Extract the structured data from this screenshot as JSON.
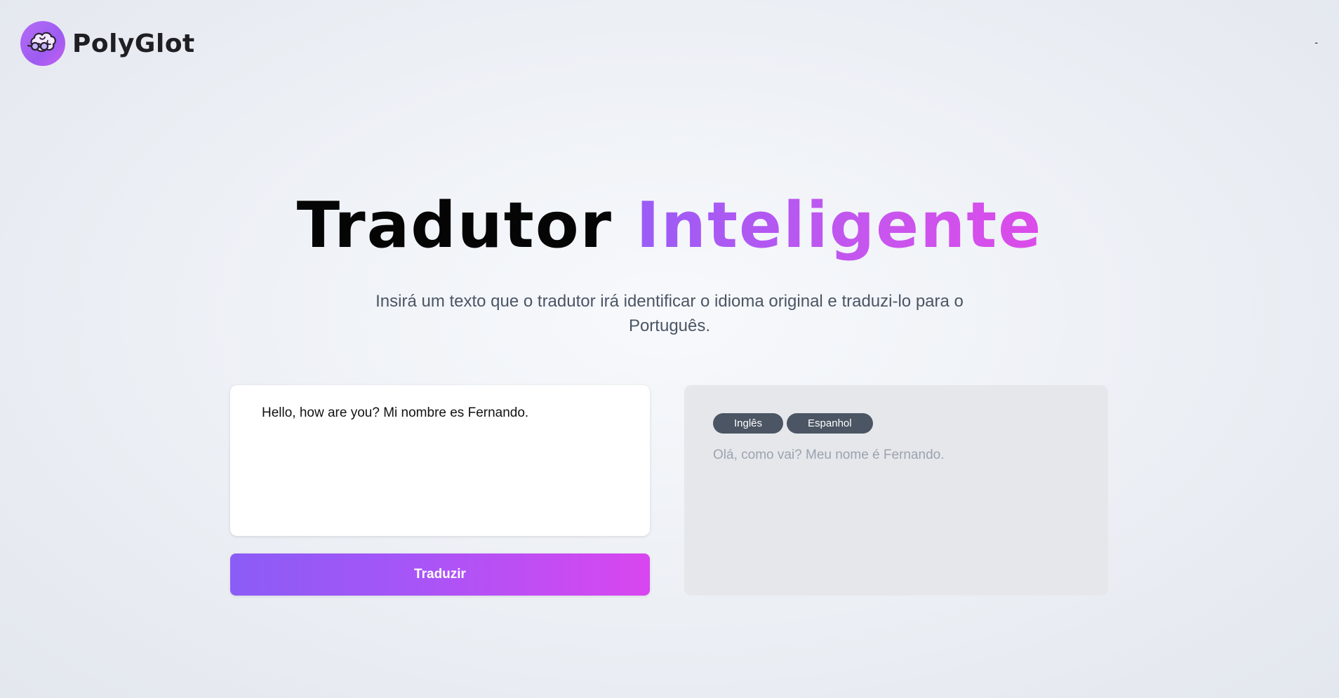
{
  "header": {
    "brand": "PolyGlot",
    "logo_icon": "brain-with-glasses-icon",
    "right_text": "-"
  },
  "hero": {
    "title_plain": "Tradutor",
    "title_highlight": "Inteligente",
    "subtitle": "Insirá um texto que o tradutor irá identificar o idioma original e traduzi-lo para o Português."
  },
  "input": {
    "value": "Hello, how are you? Mi nombre es Fernando.",
    "button_label": "Traduzir"
  },
  "output": {
    "detected_languages": [
      "Inglês",
      "Espanhol"
    ],
    "translation": "Olá, como vai? Meu nome é Fernando."
  },
  "colors": {
    "accent_start": "#8b5cf6",
    "accent_end": "#d946ef",
    "badge_bg": "#4b5563",
    "output_bg": "#e5e7eb"
  }
}
